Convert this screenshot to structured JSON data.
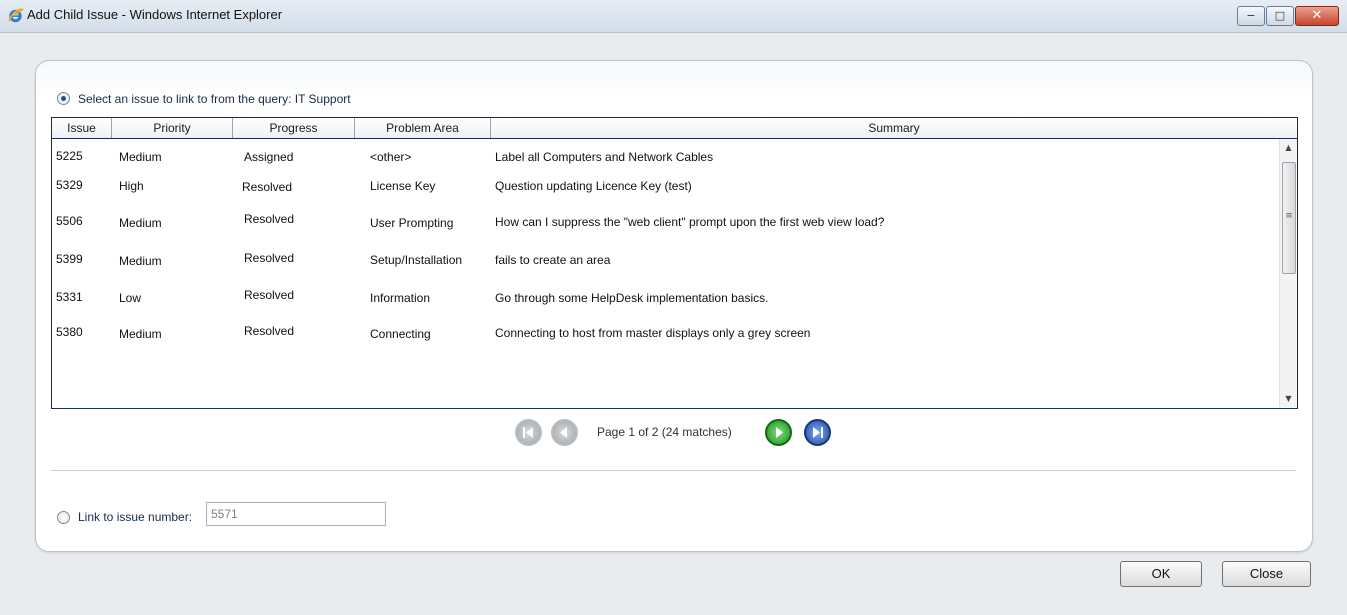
{
  "window": {
    "title": "Add Child Issue - Windows Internet Explorer",
    "minimize_glyph": "−",
    "maximize_glyph": "□",
    "close_glyph": "✕"
  },
  "query": {
    "label": "Select an issue to link to from the query: IT Support",
    "selected": true
  },
  "table": {
    "columns": [
      "Issue",
      "Priority",
      "Progress",
      "Problem Area",
      "Summary"
    ],
    "rows": [
      {
        "issue": "5225",
        "priority": "Medium",
        "progress": "Assigned",
        "area": "<other>",
        "summary": "Label all Computers and Network Cables"
      },
      {
        "issue": "5329",
        "priority": "High",
        "progress": "Resolved",
        "area": "License Key",
        "summary": "Question updating Licence Key (test)"
      },
      {
        "issue": "5506",
        "priority": "Medium",
        "progress": "Resolved",
        "area": "User Prompting",
        "summary": "How can I suppress the \"web client\" prompt upon the first web view load?"
      },
      {
        "issue": "5399",
        "priority": "Medium",
        "progress": "Resolved",
        "area": "Setup/Installation",
        "summary": "fails to create an area"
      },
      {
        "issue": "5331",
        "priority": "Low",
        "progress": "Resolved",
        "area": "Information",
        "summary": "Go through some HelpDesk implementation basics."
      },
      {
        "issue": "5380",
        "priority": "Medium",
        "progress": "Resolved",
        "area": "Connecting",
        "summary": "Connecting to host from master displays only a grey screen"
      }
    ]
  },
  "pager": {
    "text": "Page 1 of 2 (24 matches)",
    "first_icon": "first-page-icon",
    "prev_icon": "previous-page-icon",
    "next_icon": "next-page-icon",
    "last_icon": "last-page-icon"
  },
  "link": {
    "label": "Link to issue number:",
    "value": "5571",
    "selected": false
  },
  "buttons": {
    "ok": "OK",
    "close": "Close"
  }
}
